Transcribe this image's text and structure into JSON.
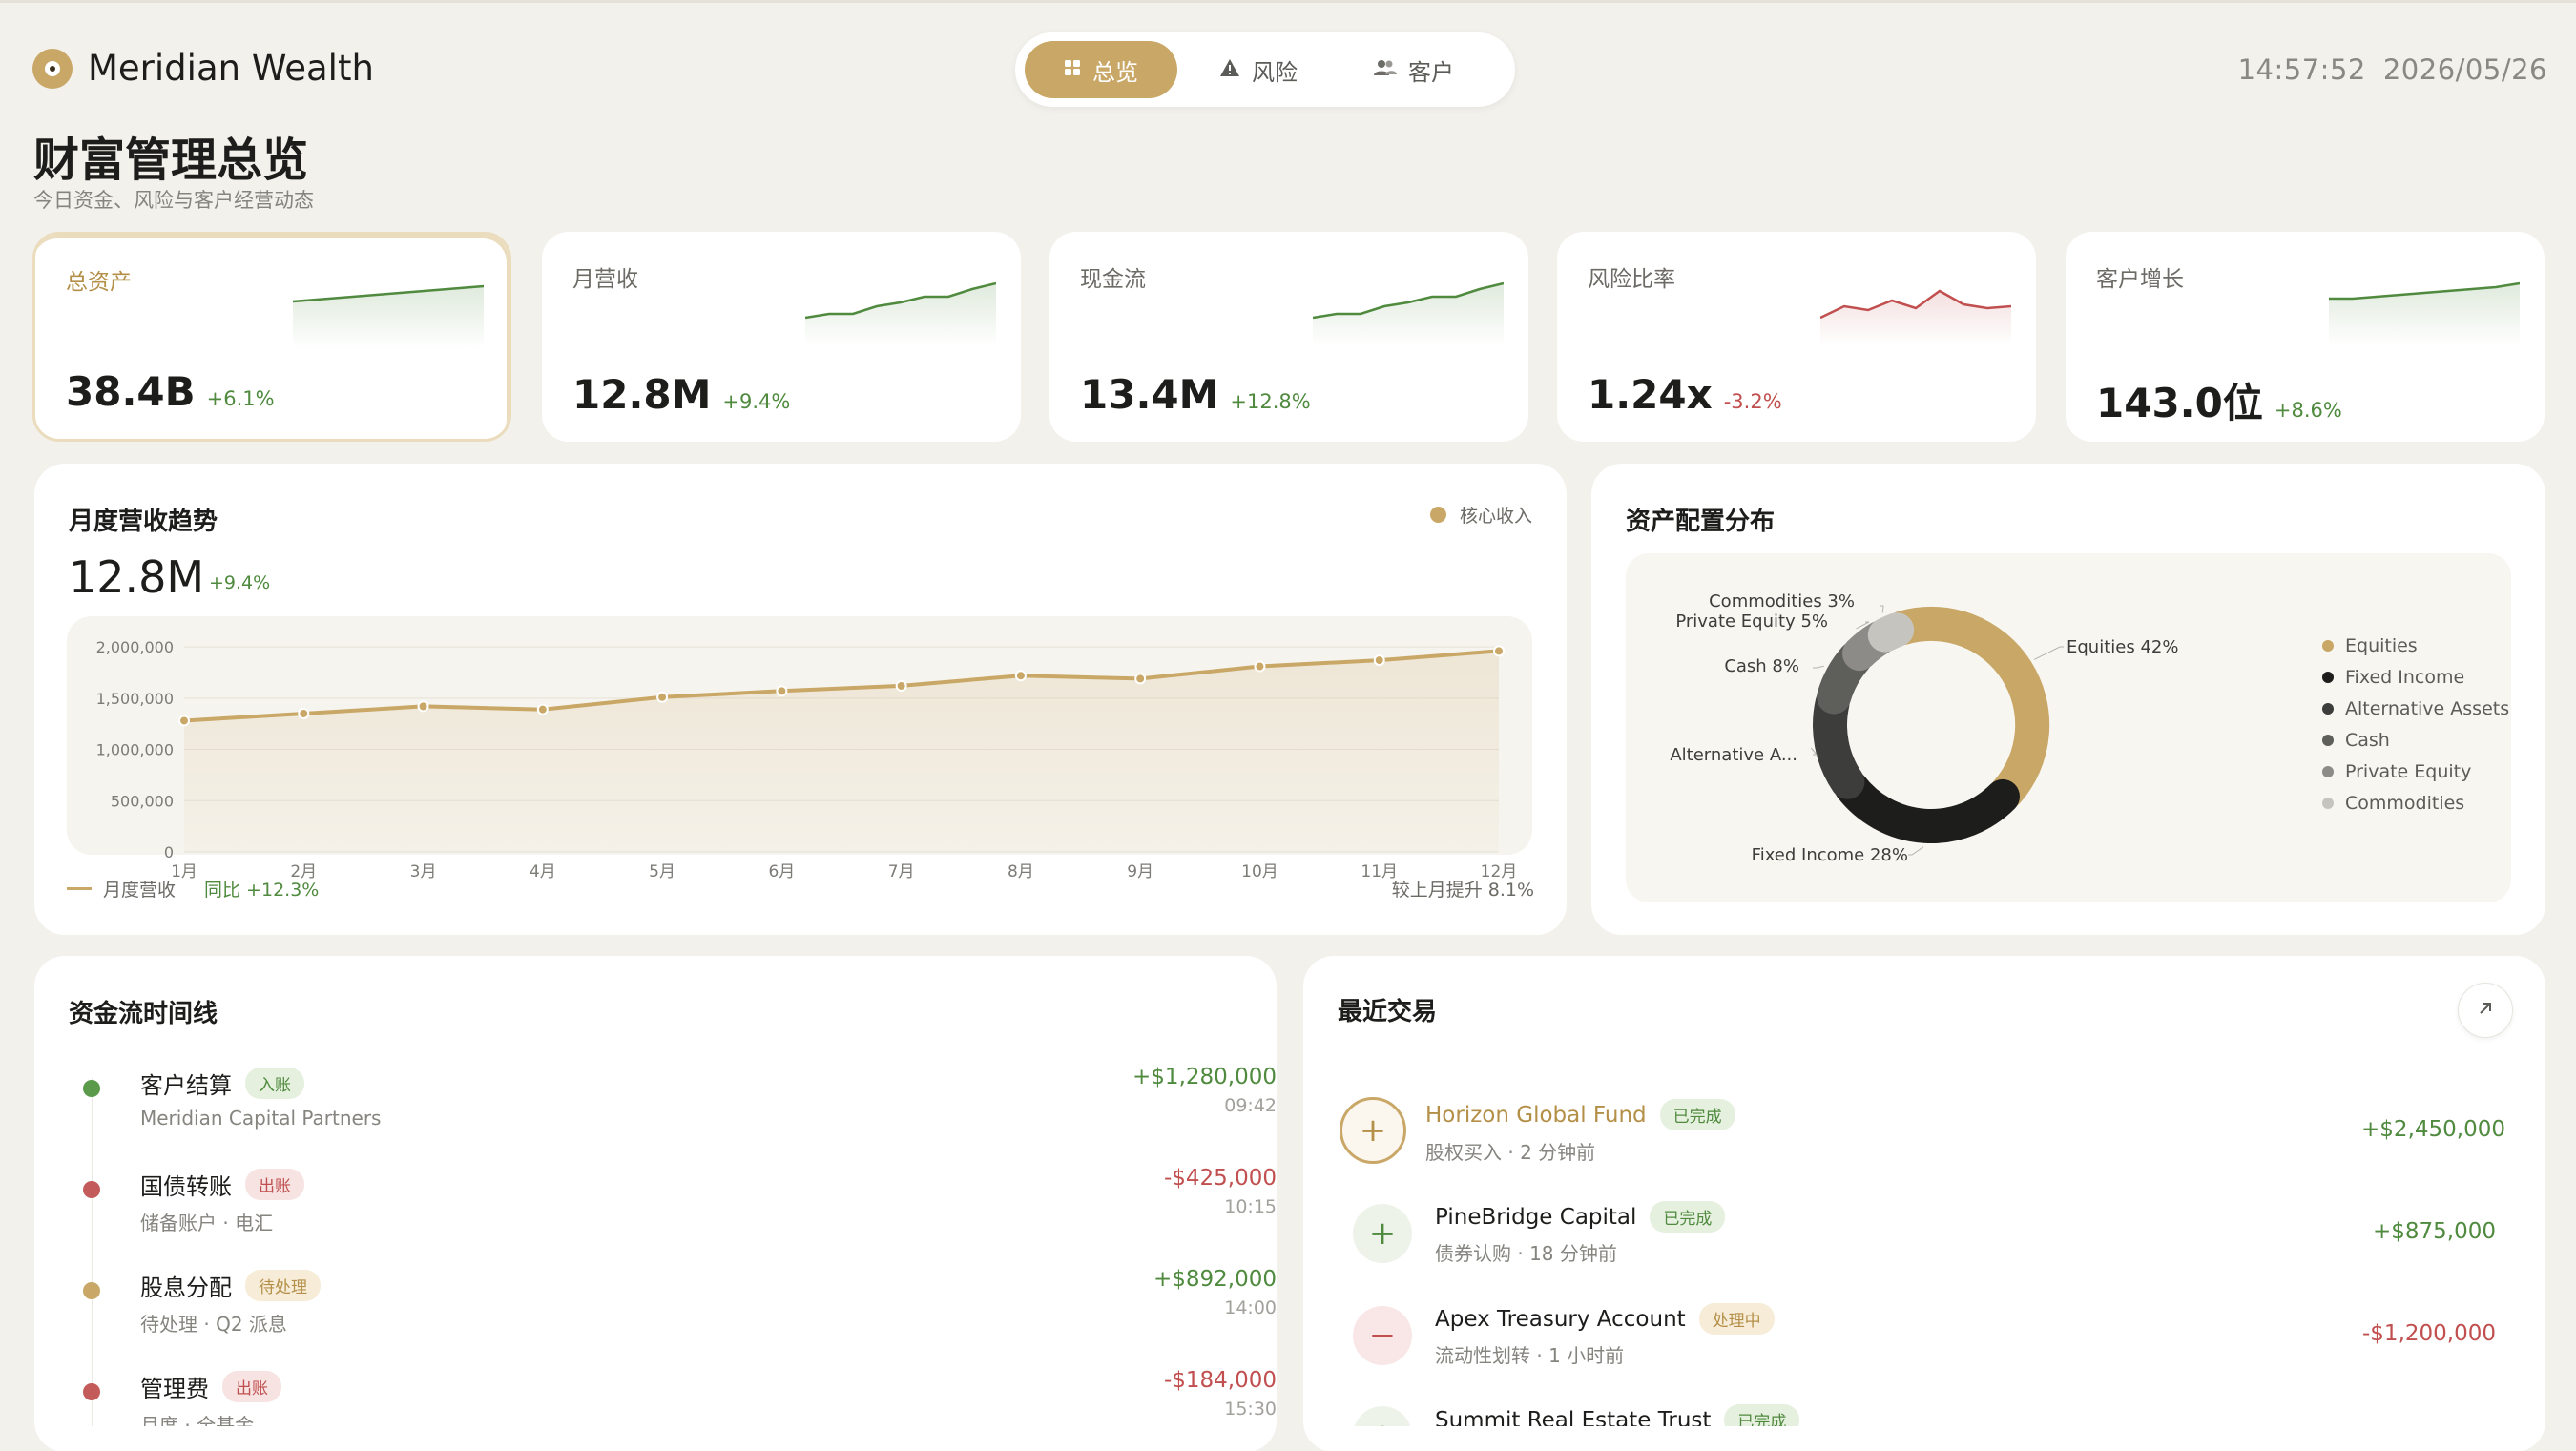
{
  "brand": {
    "name": "Meridian Wealth",
    "logo_icon": "coin-logo-icon"
  },
  "nav": {
    "tabs": [
      {
        "label": "总览",
        "icon": "grid-icon",
        "active": true
      },
      {
        "label": "风险",
        "icon": "warning-icon",
        "active": false
      },
      {
        "label": "客户",
        "icon": "users-icon",
        "active": false
      }
    ]
  },
  "clock": {
    "time": "14:57:52",
    "date": "2026/05/26"
  },
  "page": {
    "title": "财富管理总览",
    "subtitle": "今日资金、风险与客户经营动态"
  },
  "colors": {
    "accent": "#c9a766",
    "positive": "#4f8a3e",
    "negative": "#c14f4f",
    "background": "#f3f1ec"
  },
  "kpis": [
    {
      "label": "总资产",
      "value": "38.4B",
      "change": "+6.1%",
      "trend": "up",
      "spark": [
        50,
        51,
        52,
        53,
        54,
        55,
        56,
        57,
        58
      ]
    },
    {
      "label": "月营收",
      "value": "12.8M",
      "change": "+9.4%",
      "trend": "up",
      "spark": [
        40,
        42,
        42,
        46,
        48,
        51,
        51,
        55,
        58
      ]
    },
    {
      "label": "现金流",
      "value": "13.4M",
      "change": "+12.8%",
      "trend": "up",
      "spark": [
        40,
        42,
        42,
        46,
        48,
        51,
        51,
        55,
        58
      ]
    },
    {
      "label": "风险比率",
      "value": "1.24x",
      "change": "-3.2%",
      "trend": "down",
      "spark": [
        40,
        46,
        44,
        49,
        45,
        54,
        47,
        45,
        46
      ]
    },
    {
      "label": "客户增长",
      "value": "143.0位",
      "change": "+8.6%",
      "trend": "up",
      "spark": [
        50,
        50,
        51,
        52,
        53,
        54,
        55,
        56,
        58
      ]
    }
  ],
  "revenue": {
    "title": "月度营收趋势",
    "value": "12.8M",
    "change": "+9.4%",
    "legend": "核心收入",
    "footer_series": "月度营收",
    "footer_yoy": "同比 +12.3%",
    "footer_note": "较上月提升 8.1%"
  },
  "chart_data": [
    {
      "type": "area",
      "x": [
        "1月",
        "2月",
        "3月",
        "4月",
        "5月",
        "6月",
        "7月",
        "8月",
        "9月",
        "10月",
        "11月",
        "12月"
      ],
      "y_ticks": [
        "0",
        "500,000",
        "1,000,000",
        "1,500,000",
        "2,000,000"
      ],
      "ylim": [
        0,
        2150000
      ],
      "grid": true,
      "legend": "top-right",
      "series": [
        {
          "name": "核心收入",
          "values": [
            1280000,
            1350000,
            1420000,
            1390000,
            1510000,
            1570000,
            1620000,
            1720000,
            1690000,
            1810000,
            1870000,
            1960000
          ]
        }
      ]
    },
    {
      "type": "pie",
      "title": "资产配置分布",
      "legend": "right",
      "slices": [
        {
          "name": "Equities",
          "label": "Equities 42%",
          "value": 42,
          "color": "#c9a766"
        },
        {
          "name": "Fixed Income",
          "label": "Fixed Income 28%",
          "value": 28,
          "color": "#1d1d1b"
        },
        {
          "name": "Alternative Assets",
          "label": "Alternative A...",
          "value": 14,
          "color": "#3d3d3b"
        },
        {
          "name": "Cash",
          "label": "Cash 8%",
          "value": 8,
          "color": "#5e5e5b"
        },
        {
          "name": "Private Equity",
          "label": "Private Equity 5%",
          "value": 5,
          "color": "#8c8b87"
        },
        {
          "name": "Commodities",
          "label": "Commodities 3%",
          "value": 3,
          "color": "#c6c4bf"
        }
      ]
    }
  ],
  "allocation": {
    "title": "资产配置分布"
  },
  "timeline": {
    "title": "资金流时间线",
    "items": [
      {
        "title": "客户结算",
        "badge": "入账",
        "badge_type": "in",
        "sub": "Meridian Capital Partners",
        "amount": "+$1,280,000",
        "time": "09:42",
        "dot": "#5a9a4a"
      },
      {
        "title": "国债转账",
        "badge": "出账",
        "badge_type": "out",
        "sub": "储备账户 · 电汇",
        "amount": "-$425,000",
        "time": "10:15",
        "dot": "#c45b5b"
      },
      {
        "title": "股息分配",
        "badge": "待处理",
        "badge_type": "pending",
        "sub": "待处理 · Q2 派息",
        "amount": "+$892,000",
        "time": "14:00",
        "dot": "#c9a766"
      },
      {
        "title": "管理费",
        "badge": "出账",
        "badge_type": "out",
        "sub": "月度 · 全基金",
        "amount": "-$184,000",
        "time": "15:30",
        "dot": "#c45b5b"
      }
    ]
  },
  "transactions": {
    "title": "最近交易",
    "expand_icon": "arrow-up-right-icon",
    "items": [
      {
        "name": "Horizon Global Fund",
        "badge": "已完成",
        "badge_type": "done",
        "sub": "股权买入 · 2 分钟前",
        "amount": "+$2,450,000",
        "icon": "plus-icon"
      },
      {
        "name": "PineBridge Capital",
        "badge": "已完成",
        "badge_type": "done",
        "sub": "债券认购 · 18 分钟前",
        "amount": "+$875,000",
        "icon": "plus-icon"
      },
      {
        "name": "Apex Treasury Account",
        "badge": "处理中",
        "badge_type": "proc",
        "sub": "流动性划转 · 1 小时前",
        "amount": "-$1,200,000",
        "icon": "minus-icon"
      },
      {
        "name": "Summit Real Estate Trust",
        "badge": "已完成",
        "badge_type": "done",
        "sub": "",
        "amount": "",
        "icon": "plus-icon"
      }
    ]
  }
}
